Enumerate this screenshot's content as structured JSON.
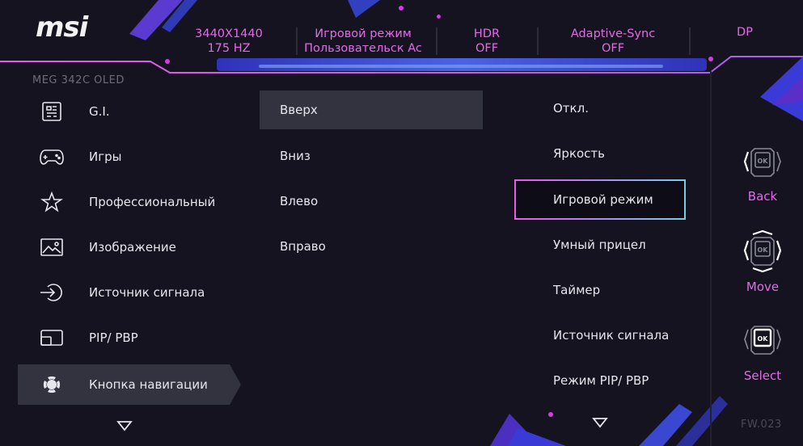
{
  "brand": "msi",
  "model": "MEG 342C OLED",
  "status_bar": {
    "resolution": "3440X1440",
    "refresh": "175 HZ",
    "mode_title": "Игровой режим",
    "mode_value": "Пользовательск Ac",
    "hdr_title": "HDR",
    "hdr_value": "OFF",
    "sync_title": "Adaptive-Sync",
    "sync_value": "OFF",
    "input": "DP"
  },
  "menu": {
    "items": [
      {
        "label": "G.I.",
        "icon": "gaming-intelligence-icon"
      },
      {
        "label": "Игры",
        "icon": "gamepad-icon"
      },
      {
        "label": "Профессиональный",
        "icon": "star-icon"
      },
      {
        "label": "Изображение",
        "icon": "image-icon"
      },
      {
        "label": "Источник сигнала",
        "icon": "input-source-icon"
      },
      {
        "label": "PIP/ PBP",
        "icon": "pip-icon"
      },
      {
        "label": "Кнопка навигации",
        "icon": "navigation-button-icon",
        "active": true
      }
    ]
  },
  "submenu": {
    "items": [
      "Вверх",
      "Вниз",
      "Влево",
      "Вправо"
    ],
    "active_index": 0
  },
  "options": {
    "items": [
      "Откл.",
      "Яркость",
      "Игровой режим",
      "Умный прицел",
      "Таймер",
      "Источник сигнала",
      "Режим PIP/ PBP"
    ],
    "selected_index": 2
  },
  "nav_buttons": [
    {
      "label": "Back",
      "icon": "joystick-back-icon"
    },
    {
      "label": "Move",
      "icon": "joystick-move-icon"
    },
    {
      "label": "Select",
      "icon": "joystick-select-icon"
    }
  ],
  "firmware": "FW.023",
  "colors": {
    "accent": "#e36be6",
    "background": "#14131f",
    "highlight": "#33323f",
    "decor_blue": "#3a3bd6",
    "decor_purple": "#5a2fc8"
  }
}
